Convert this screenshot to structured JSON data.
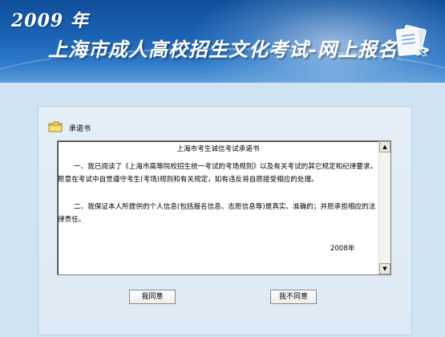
{
  "header": {
    "year": "2009 年",
    "title": "上海市成人高校招生文化考试-网上报名>>"
  },
  "section": {
    "label": "承诺书"
  },
  "document": {
    "title": "上海市考生诚信考试承诺书",
    "paragraph_1": "一、我已阅读了《上海市高等院校招生统一考试的考场规则》以及有关考试的其它规定和纪律要求，愿意在考试中自觉遵守考生(考场)规则和有关规定，如有违反将自愿接受相应的处理。",
    "paragraph_2": "二、我保证本人所提供的个人信息(包括报名信息、志愿信息等)是真实、准确的；并愿承担相应的法律责任。",
    "signature_year": "2008年"
  },
  "buttons": {
    "agree": "我同意",
    "disagree": "我不同意"
  },
  "colors": {
    "banner_primary": "#1c63b4",
    "page_background": "#cfe3f3",
    "panel_background": "#e4eef7"
  }
}
